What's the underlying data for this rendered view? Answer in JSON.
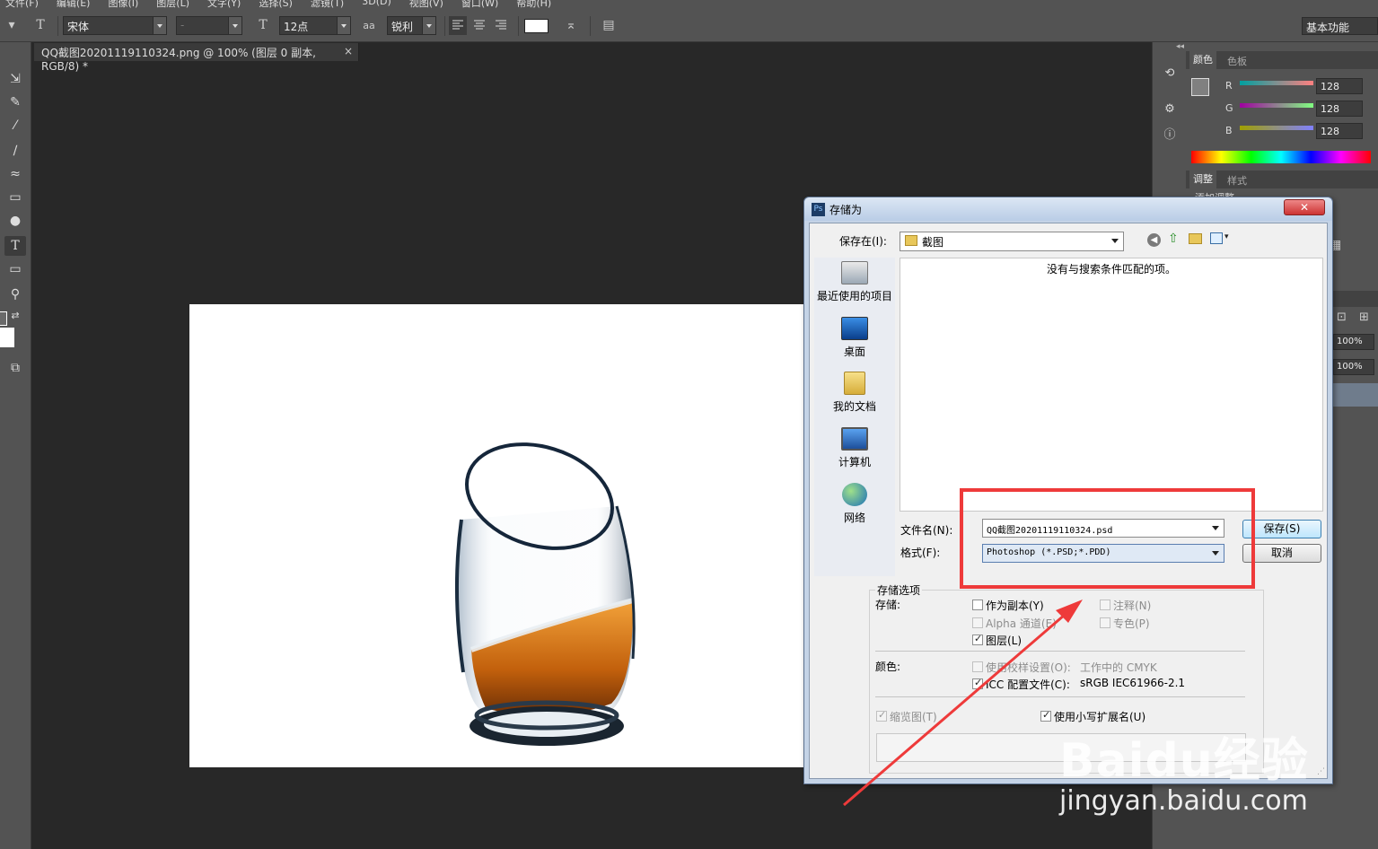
{
  "menubar": {
    "items": [
      "文件(F)",
      "编辑(E)",
      "图像(I)",
      "图层(L)",
      "文字(Y)",
      "选择(S)",
      "滤镜(T)",
      "3D(D)",
      "视图(V)",
      "窗口(W)",
      "帮助(H)"
    ]
  },
  "options": {
    "font_family": "宋体",
    "font_style": "-",
    "font_size": "12点",
    "aa_icon_text": "aa",
    "antialias": "锐利",
    "workspace": "基本功能"
  },
  "document": {
    "tab_title": "QQ截图20201119110324.png @ 100% (图层 0 副本, RGB/8) *",
    "close": "×"
  },
  "panels": {
    "collapse": "◂◂",
    "color_tabs": [
      "颜色",
      "色板"
    ],
    "channels": [
      {
        "label": "R",
        "value": "128"
      },
      {
        "label": "G",
        "value": "128"
      },
      {
        "label": "B",
        "value": "128"
      }
    ],
    "adjust_tabs": [
      "调整",
      "样式"
    ],
    "adjust_partial": "添加调整",
    "opacity": "100%",
    "fill": "100%"
  },
  "dialog": {
    "title": "存储为",
    "close": "✕",
    "save_in_label": "保存在(I):",
    "folder": "截图",
    "empty_message": "没有与搜索条件匹配的项。",
    "places": [
      "最近使用的项目",
      "桌面",
      "我的文档",
      "计算机",
      "网络"
    ],
    "filename_label": "文件名(N):",
    "filename_value": "QQ截图20201119110324.psd",
    "format_label": "格式(F):",
    "format_value": "Photoshop (*.PSD;*.PDD)",
    "save_button": "保存(S)",
    "cancel_button": "取消",
    "options_group": "存储选项",
    "store_label": "存储:",
    "as_copy": "作为副本(Y)",
    "notes": "注释(N)",
    "alpha": "Alpha 通道(E)",
    "spot": "专色(P)",
    "layers": "图层(L)",
    "color_label": "颜色:",
    "use_proof": "使用校样设置(O):",
    "proof_value": "工作中的 CMYK",
    "icc": "ICC 配置文件(C):",
    "icc_value": "sRGB IEC61966-2.1",
    "thumbnail": "缩览图(T)",
    "lowercase_ext": "使用小写扩展名(U)"
  },
  "watermark": {
    "brand": "Baidu经验",
    "url": "jingyan.baidu.com"
  },
  "colors": {
    "annotation_red": "#ee3a3a",
    "ps_dark": "#282828",
    "ps_panel": "#535353"
  }
}
